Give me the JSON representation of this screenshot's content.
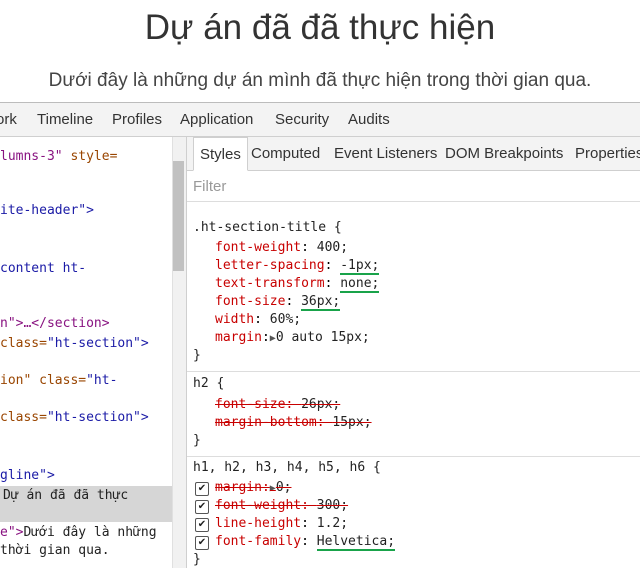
{
  "page": {
    "title": "Dự án đã đã thực hiện",
    "subtitle": "Dưới đây là những dự án mình đã thực hiện trong thời gian qua."
  },
  "devtools": {
    "tabs": [
      "ork",
      "Timeline",
      "Profiles",
      "Application",
      "Security",
      "Audits"
    ],
    "elements_lines": [
      {
        "tag": "lumns-3\"",
        "attr": " style=",
        "val": ""
      },
      {
        "tag": "",
        "attr": "",
        "val": "ite-header\">"
      },
      {
        "tag": "",
        "attr": "",
        "val": "content ht-"
      },
      {
        "tag": "n\">…</section>",
        "attr": "",
        "val": ""
      },
      {
        "tag": "",
        "attr": "class=",
        "val": "\"ht-section\">"
      },
      {
        "tag": "",
        "attr": "ion\" class=",
        "val": "\"ht-"
      },
      {
        "tag": "",
        "attr": " class=",
        "val": "\"ht-section\">"
      },
      {
        "tag": "",
        "attr": "",
        "val": "gline\">"
      },
      {
        "tag": "",
        "attr": "",
        "val": "Dự án đã đã thực"
      },
      {
        "tag": "e\">",
        "attr": "",
        "val": "Dưới đây là những"
      },
      {
        "tag": "",
        "attr": "",
        "val": " thời gian qua."
      }
    ],
    "sidebar_tabs": [
      "Styles",
      "Computed",
      "Event Listeners",
      "DOM Breakpoints",
      "Properties"
    ],
    "filter_placeholder": "Filter",
    "rules": [
      {
        "selector": ".ht-section-title {",
        "props": [
          {
            "name": "font-weight",
            "value": "400;"
          },
          {
            "name": "letter-spacing",
            "value": "-1px;"
          },
          {
            "name": "text-transform",
            "value": "none;"
          },
          {
            "name": "font-size",
            "value": "36px;"
          },
          {
            "name": "width",
            "value": "60%;"
          },
          {
            "name": "margin",
            "value": "0 auto 15px;"
          }
        ],
        "close": "}"
      },
      {
        "selector": "h2 {",
        "props": [
          {
            "name": "font-size",
            "value": "26px;"
          },
          {
            "name": "margin-bottom",
            "value": "15px;"
          }
        ],
        "close": "}"
      },
      {
        "selector": "h1, h2, h3, h4, h5, h6 {",
        "props": [
          {
            "name": "margin",
            "value": "0;"
          },
          {
            "name": "font-weight",
            "value": "300;"
          },
          {
            "name": "line-height",
            "value": "1.2;"
          },
          {
            "name": "font-family",
            "value": "Helvetica;"
          }
        ],
        "close": "}"
      }
    ],
    "checkmark": "✔",
    "expand_arrow": "▶"
  },
  "colors": {
    "underline": "#19a34a",
    "property": "#c80000",
    "tag": "#881280",
    "attr_value": "#1a1aa6"
  }
}
